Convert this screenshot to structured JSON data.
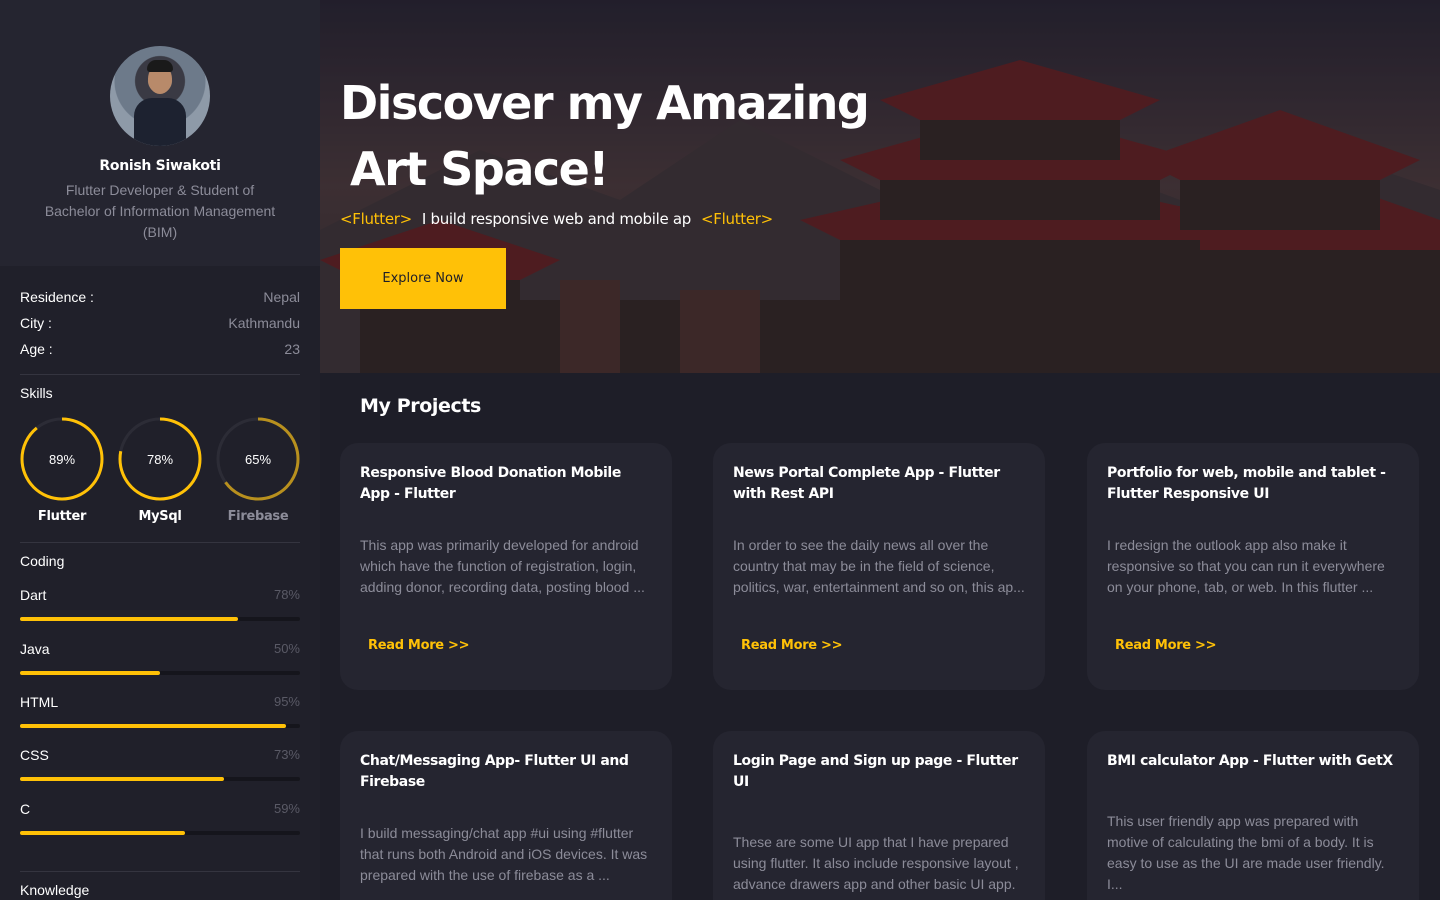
{
  "profile": {
    "name": "Ronish Siwakoti",
    "bio": "Flutter Developer & Student of Bachelor of Information Management (BIM)"
  },
  "info": [
    {
      "key": "Residence :",
      "value": "Nepal"
    },
    {
      "key": "City :",
      "value": "Kathmandu"
    },
    {
      "key": "Age :",
      "value": "23"
    }
  ],
  "skills": {
    "title": "Skills",
    "items": [
      {
        "label": "Flutter",
        "percent_text": "89%",
        "percent": 89
      },
      {
        "label": "MySql",
        "percent_text": "78%",
        "percent": 78
      },
      {
        "label": "Firebase",
        "percent_text": "65%",
        "percent": 65
      }
    ]
  },
  "coding": {
    "title": "Coding",
    "items": [
      {
        "label": "Dart",
        "percent_text": "78%",
        "percent": 78
      },
      {
        "label": "Java",
        "percent_text": "50%",
        "percent": 50
      },
      {
        "label": "HTML",
        "percent_text": "95%",
        "percent": 95
      },
      {
        "label": "CSS",
        "percent_text": "73%",
        "percent": 73
      },
      {
        "label": "C",
        "percent_text": "59%",
        "percent": 59
      }
    ]
  },
  "knowledge": {
    "title": "Knowledge"
  },
  "hero": {
    "title_line1": "Discover my Amazing",
    "title_line2": "Art Space!",
    "tag_open": "<Flutter>",
    "subtitle": "I build responsive web and mobile ap",
    "tag_close": "<Flutter>",
    "button": "Explore Now"
  },
  "projects": {
    "title": "My Projects",
    "read_more": "Read More >>",
    "items": [
      {
        "title": "Responsive Blood Donation Mobile App - Flutter",
        "desc": "This app was primarily developed for android which have the function of registration, login, adding donor, recording data, posting blood ..."
      },
      {
        "title": "News Portal Complete  App - Flutter with Rest API",
        "desc": "In order to see the daily news all over the country that may be in the field of science, politics, war, entertainment and so on, this ap..."
      },
      {
        "title": " Portfolio for web, mobile and tablet - Flutter Responsive UI",
        "desc": "I redesign the outlook app also make it responsive so that you can run it everywhere on your phone, tab, or web. In this flutter ..."
      },
      {
        "title": "Chat/Messaging App- Flutter UI and Firebase",
        "desc": "I build messaging/chat app #ui using #flutter that runs both Android and iOS devices. It was prepared with the use of firebase as a ..."
      },
      {
        "title": " Login Page and Sign up page - Flutter UI",
        "desc": "These are some UI app that I have prepared using flutter. It also include responsive layout , advance drawers app and other basic UI app. ..."
      },
      {
        "title": "BMI calculator App - Flutter with GetX",
        "desc": "This user friendly app was prepared with motive of calculating the bmi of a body. It is easy to use as the UI are made user friendly. I..."
      }
    ]
  },
  "colors": {
    "accent": "#ffc107",
    "sidebar": "#20202a",
    "card": "#252530",
    "background": "#1e1e28"
  }
}
